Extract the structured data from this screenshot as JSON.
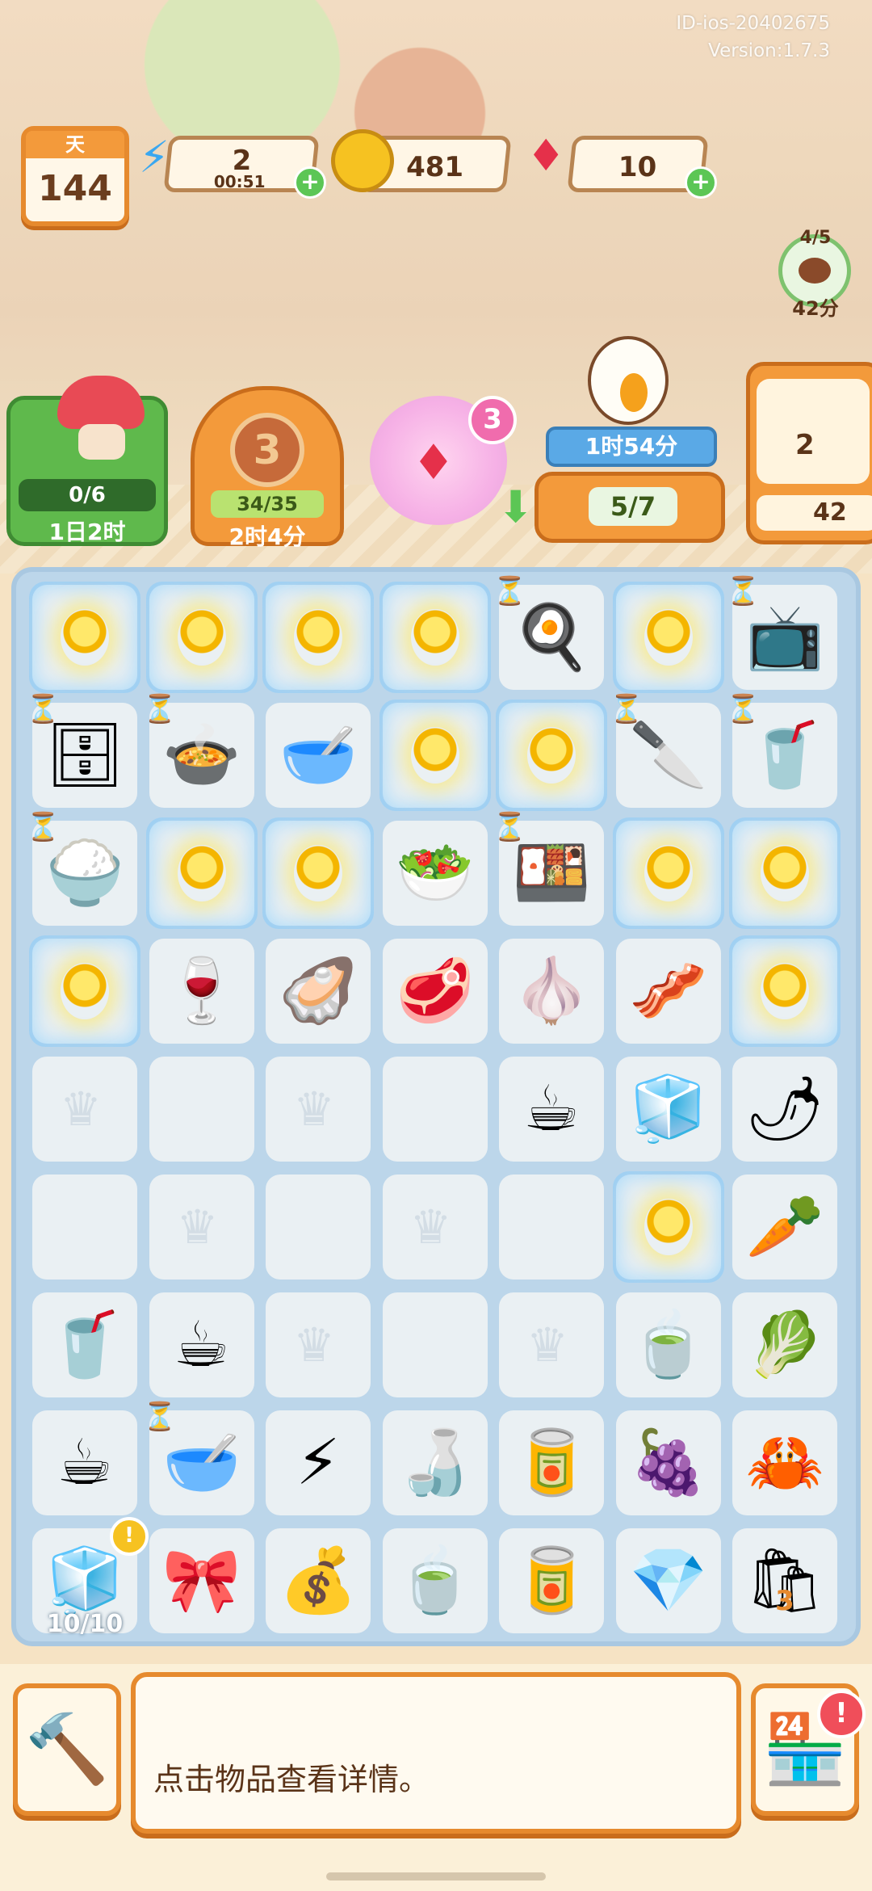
{
  "build": {
    "id": "ID-ios-20402675",
    "version": "Version:1.7.3"
  },
  "day": {
    "label": "天",
    "value": "144"
  },
  "energy": {
    "value": "2",
    "timer": "00:51",
    "icon": "lightning-icon"
  },
  "coins": {
    "value": "481",
    "icon": "coin-icon"
  },
  "gems": {
    "value": "10",
    "icon": "ruby-icon"
  },
  "side_event": {
    "progress": "4/5",
    "time": "42分"
  },
  "cards": {
    "mushroom": {
      "progress": "0/6",
      "time": "1日2时"
    },
    "level": {
      "level": "3",
      "progress": "34/35",
      "time": "2时4分"
    },
    "gem_bubble": {
      "count": "3"
    },
    "chef": {
      "timer": "1时54分",
      "progress": "5/7"
    },
    "worker": {
      "count": "2",
      "coins": "42"
    }
  },
  "board_rows": [
    [
      "locked-crate-glow",
      "locked-box-glow",
      "locked-plate-glow",
      "locked-basket-glow",
      "grill-pan",
      "locked-slicer-glow",
      "microwave"
    ],
    [
      "toaster-oven",
      "stove-cooker",
      "cutting-board",
      "locked-rack-glow",
      "locked-jar-glow",
      "knife-block",
      "juicer"
    ],
    [
      "rice-cooker",
      "locked-basket2-glow",
      "locked-bowl-glow",
      "veggie-pile",
      "warming-tray",
      "locked-salad-glow",
      "locked-display-glow"
    ],
    [
      "locked-ice-glow",
      "red-wine",
      "clam",
      "steak",
      "garlic-plate",
      "ribs",
      "locked-cheese-glow"
    ],
    [
      "empty-chef",
      "empty",
      "empty-chef",
      "empty",
      "coffee-cup-beans",
      "ice-cube",
      "chili-plate"
    ],
    [
      "empty",
      "empty-chef",
      "empty",
      "empty-chef",
      "empty",
      "locked-flower-glow",
      "carrot"
    ],
    [
      "coffee-to-go",
      "coffee-cup",
      "empty-chef",
      "empty",
      "empty-chef",
      "green-tea",
      "leek-plate"
    ],
    [
      "latte",
      "glass-bowl",
      "energy-drop",
      "water-bottle",
      "soda-can",
      "grapes",
      "crab"
    ],
    [
      "blue-dispenser",
      "blue-bow",
      "herb-sack",
      "tea-cup",
      "ginger-jar",
      "blue-crystal",
      "flour-bag"
    ]
  ],
  "board_icons": {
    "grill-pan": "🍳",
    "microwave": "📺",
    "toaster-oven": "🗄",
    "stove-cooker": "🍲",
    "cutting-board": "🥣",
    "knife-block": "🔪",
    "juicer": "🥤",
    "rice-cooker": "🍚",
    "veggie-pile": "🥗",
    "warming-tray": "🍱",
    "red-wine": "🍷",
    "clam": "🦪",
    "steak": "🥩",
    "garlic-plate": "🧄",
    "ribs": "🥓",
    "coffee-cup-beans": "☕",
    "ice-cube": "🧊",
    "chili-plate": "🌶",
    "carrot": "🥕",
    "coffee-to-go": "🥤",
    "coffee-cup": "☕",
    "green-tea": "🍵",
    "leek-plate": "🥬",
    "latte": "☕",
    "glass-bowl": "🥣",
    "energy-drop": "⚡",
    "water-bottle": "🍶",
    "soda-can": "🥫",
    "grapes": "🍇",
    "crab": "🦀",
    "blue-dispenser": "🧊",
    "blue-bow": "🎀",
    "herb-sack": "💰",
    "tea-cup": "🍵",
    "ginger-jar": "🥫",
    "blue-crystal": "💎",
    "flour-bag": "🛍"
  },
  "timers_on": [
    "0-4",
    "0-6",
    "1-0",
    "1-1",
    "1-5",
    "1-6",
    "2-0",
    "2-4",
    "7-1"
  ],
  "dispenser_count": "10/10",
  "flour_number": "3",
  "toolbar": {
    "message": "点击物品查看详情。",
    "left_icon": "hammer-icon",
    "right_icon": "shop-icon"
  }
}
